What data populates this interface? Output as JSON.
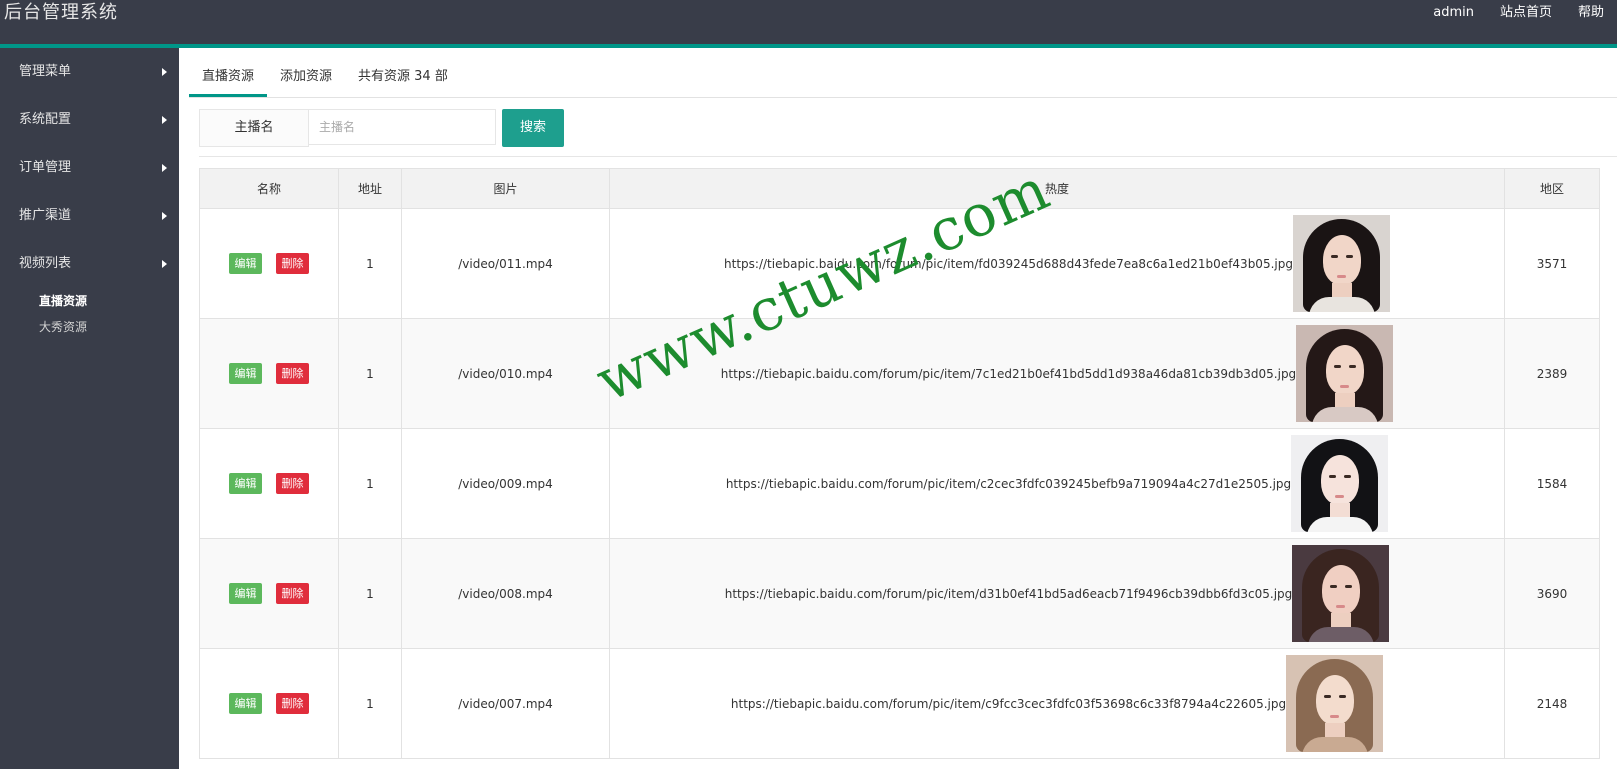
{
  "header": {
    "title": "后台管理系统",
    "links": [
      "admin",
      "站点首页",
      "帮助"
    ]
  },
  "sidebar": {
    "items": [
      {
        "label": "管理菜单"
      },
      {
        "label": "系统配置"
      },
      {
        "label": "订单管理"
      },
      {
        "label": "推广渠道"
      },
      {
        "label": "视频列表"
      }
    ],
    "subitems": [
      {
        "label": "直播资源",
        "active": true
      },
      {
        "label": "大秀资源",
        "active": false
      }
    ]
  },
  "tabs": [
    {
      "label": "直播资源",
      "active": true
    },
    {
      "label": "添加资源",
      "active": false
    },
    {
      "label": "共有资源 34 部",
      "active": false
    }
  ],
  "search": {
    "label": "主播名",
    "placeholder": "主播名",
    "button": "搜索"
  },
  "table": {
    "columns": [
      "名称",
      "地址",
      "图片",
      "热度",
      "地区"
    ],
    "edit_label": "编辑",
    "delete_label": "删除",
    "rows": [
      {
        "name_col": "1",
        "address": "/video/011.mp4",
        "image_url": "https://tiebapic.baidu.com/forum/pic/item/fd039245d688d43fede7ea8c6a1ed21b0ef43b05.jpg",
        "region": "3571"
      },
      {
        "name_col": "1",
        "address": "/video/010.mp4",
        "image_url": "https://tiebapic.baidu.com/forum/pic/item/7c1ed21b0ef41bd5dd1d938a46da81cb39db3d05.jpg",
        "region": "2389"
      },
      {
        "name_col": "1",
        "address": "/video/009.mp4",
        "image_url": "https://tiebapic.baidu.com/forum/pic/item/c2cec3fdfc039245befb9a719094a4c27d1e2505.jpg",
        "region": "1584"
      },
      {
        "name_col": "1",
        "address": "/video/008.mp4",
        "image_url": "https://tiebapic.baidu.com/forum/pic/item/d31b0ef41bd5ad6eacb71f9496cb39dbb6fd3c05.jpg",
        "region": "3690"
      },
      {
        "name_col": "1",
        "address": "/video/007.mp4",
        "image_url": "https://tiebapic.baidu.com/forum/pic/item/c9fcc3cec3fdfc03f53698c6c33f8794a4c22605.jpg",
        "region": "2148"
      }
    ]
  },
  "watermark": "www.ctuwz.com",
  "colors": {
    "header_bg": "#393d49",
    "accent": "#009688",
    "search_button": "#1e9f8e",
    "edit_button": "#5cb85c",
    "delete_button": "#e02d3c",
    "watermark": "#1d8c2e"
  }
}
